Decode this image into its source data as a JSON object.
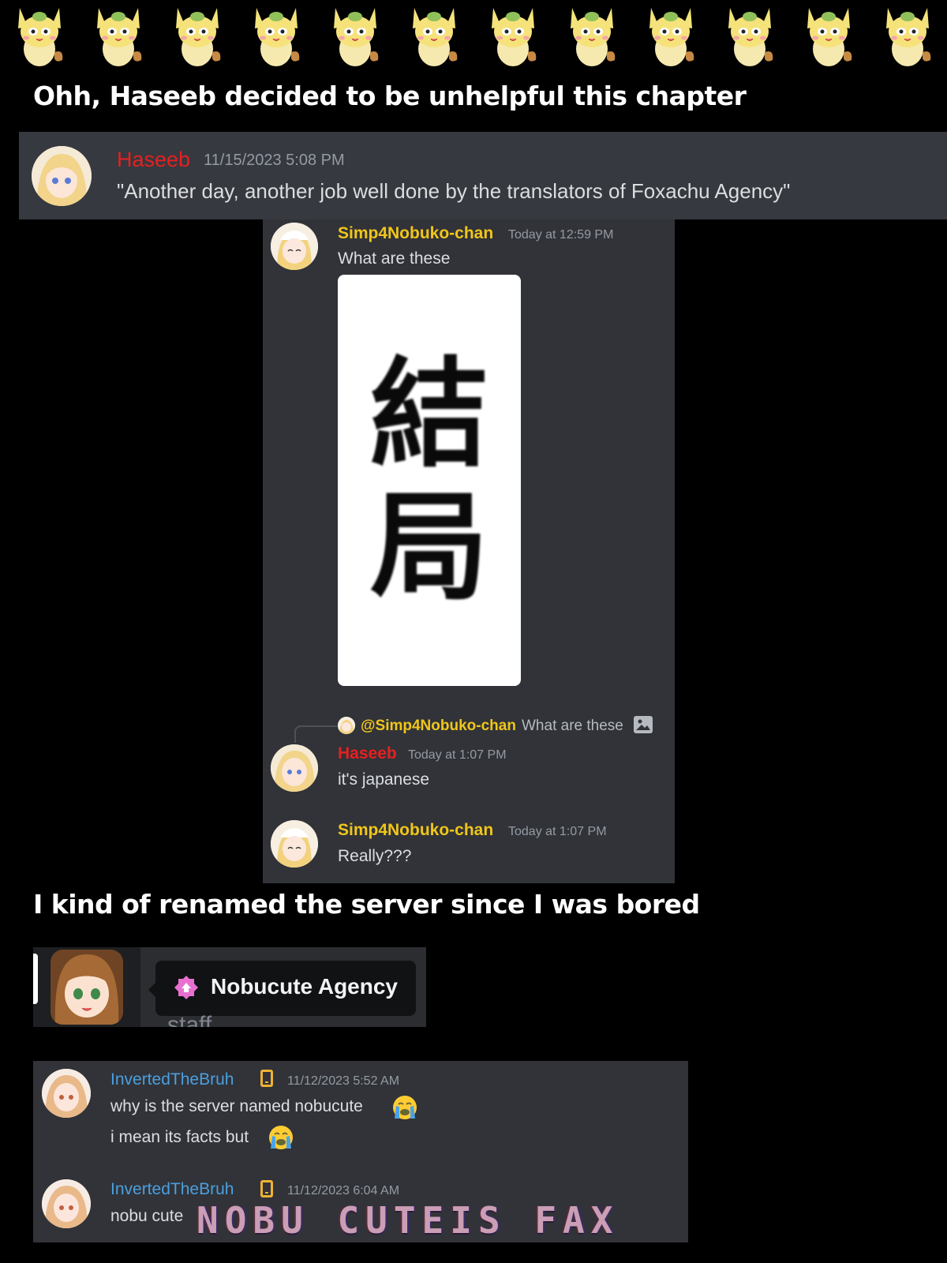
{
  "captions": {
    "top": "Ohh, Haseeb decided to be unhelpful this chapter",
    "middle": "I kind of renamed the server since I was bored"
  },
  "quote_message": {
    "username": "Haseeb",
    "timestamp": "11/15/2023 5:08 PM",
    "text": "\"Another day, another job well done by the translators of Foxachu Agency\""
  },
  "chat": {
    "msg1": {
      "username": "Simp4Nobuko-chan",
      "timestamp": "Today at 12:59 PM",
      "text": "What are these",
      "attachment_text": [
        "結",
        "局"
      ]
    },
    "reply": {
      "mention": "@Simp4Nobuko-chan",
      "snippet": "What are these"
    },
    "msg2": {
      "username": "Haseeb",
      "timestamp": "Today at 1:07 PM",
      "text": "it's japanese"
    },
    "msg3": {
      "username": "Simp4Nobuko-chan",
      "timestamp": "Today at 1:07 PM",
      "text": "Really???"
    }
  },
  "server": {
    "name": "Nobucute Agency",
    "channel_peek": "staff"
  },
  "fact_chat": {
    "msg1": {
      "username": "InvertedTheBruh",
      "timestamp": "11/12/2023 5:52 AM",
      "line1": "why is the server named nobucute",
      "line2": "i mean its facts but"
    },
    "msg2": {
      "username": "InvertedTheBruh",
      "timestamp": "11/12/2023 6:04 AM",
      "text": "nobu cute"
    },
    "overlay": "NOBU CUTEIS FAX"
  },
  "colors": {
    "haseeb": "#e62020",
    "simp": "#f0c61a",
    "inverted": "#4b9fe0",
    "panel": "#313338",
    "timestamp": "#949ba4"
  },
  "icons": [
    "fox-mascot-icon",
    "image-icon",
    "phone-icon",
    "crying-emoji-icon",
    "server-boost-icon"
  ]
}
